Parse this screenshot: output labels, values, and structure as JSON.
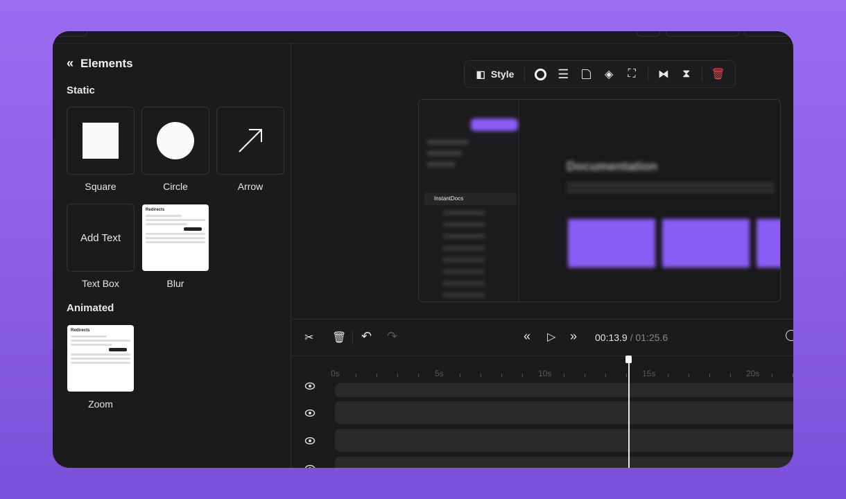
{
  "panel": {
    "title": "Elements",
    "static_heading": "Static",
    "animated_heading": "Animated",
    "static_items": [
      {
        "label": "Square"
      },
      {
        "label": "Circle"
      },
      {
        "label": "Arrow"
      },
      {
        "label": "Text Box",
        "tile_text": "Add Text"
      },
      {
        "label": "Blur"
      }
    ],
    "animated_items": [
      {
        "label": "Zoom"
      }
    ],
    "mini_dialog_title": "Redirects"
  },
  "toolbar": {
    "style_label": "Style"
  },
  "preview": {
    "sidebar_item": "InstantDocs",
    "heading": "Documentation"
  },
  "playback": {
    "current_time": "00:13.9",
    "separator": "/",
    "total_time": "01:25.6"
  },
  "ruler": {
    "labels": [
      "0s",
      "5s",
      "10s",
      "15s",
      "20s"
    ]
  },
  "colors": {
    "accent": "#8b5cf6",
    "delete": "#e5484d"
  }
}
